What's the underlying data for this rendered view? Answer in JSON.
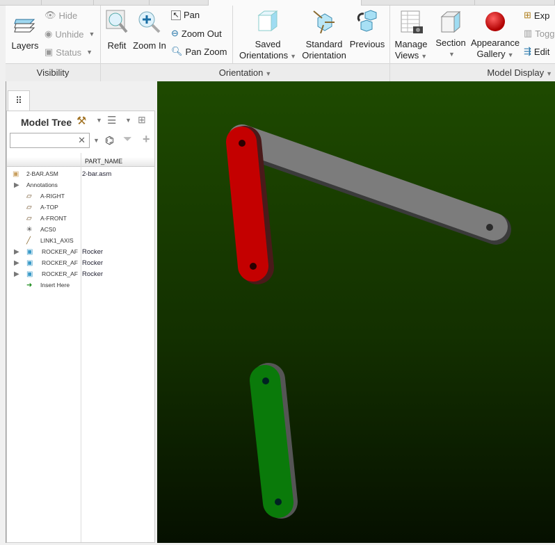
{
  "ribbon": {
    "visibility": {
      "layers": "Layers",
      "hide": "Hide",
      "unhide": "Unhide",
      "status": "Status",
      "group": "Visibility"
    },
    "orientation": {
      "refit": "Refit",
      "zoom_in": "Zoom In",
      "pan": "Pan",
      "zoom_out": "Zoom Out",
      "pan_zoom": "Pan Zoom",
      "saved_1": "Saved",
      "saved_2": "Orientations",
      "standard_1": "Standard",
      "standard_2": "Orientation",
      "previous": "Previous",
      "group": "Orientation"
    },
    "model_display": {
      "manage_1": "Manage",
      "manage_2": "Views",
      "section": "Section",
      "appearance_1": "Appearance",
      "appearance_2": "Gallery",
      "exp": "Exp",
      "togg": "Togg",
      "edit": "Edit",
      "group": "Model Display"
    }
  },
  "model_tree": {
    "title": "Model Tree",
    "search_value": "",
    "column_header": "PART_NAME",
    "items": [
      {
        "label": "2-BAR.ASM",
        "part_name": "2-bar.asm",
        "icon": "assembly-icon"
      },
      {
        "label": "Annotations",
        "part_name": "",
        "icon": "expand-arrow-icon"
      },
      {
        "label": "A-RIGHT",
        "part_name": "",
        "icon": "datum-plane-icon"
      },
      {
        "label": "A-TOP",
        "part_name": "",
        "icon": "datum-plane-icon"
      },
      {
        "label": "A-FRONT",
        "part_name": "",
        "icon": "datum-plane-icon"
      },
      {
        "label": "ACS0",
        "part_name": "",
        "icon": "coordinate-system-icon"
      },
      {
        "label": "LINK1_AXIS",
        "part_name": "",
        "icon": "axis-icon"
      },
      {
        "label": "ROCKER_AF",
        "part_name": "Rocker",
        "icon": "part-icon"
      },
      {
        "label": "ROCKER_AF",
        "part_name": "Rocker",
        "icon": "part-icon"
      },
      {
        "label": "ROCKER_AF",
        "part_name": "Rocker",
        "icon": "part-icon"
      },
      {
        "label": "Insert Here",
        "part_name": "",
        "icon": "insert-arrow-icon"
      }
    ]
  },
  "colors": {
    "viewport_top": "#1e4a00",
    "gray_link": "#7a7a7a",
    "red_link": "#c40000",
    "green_link": "#0a7a0a"
  }
}
